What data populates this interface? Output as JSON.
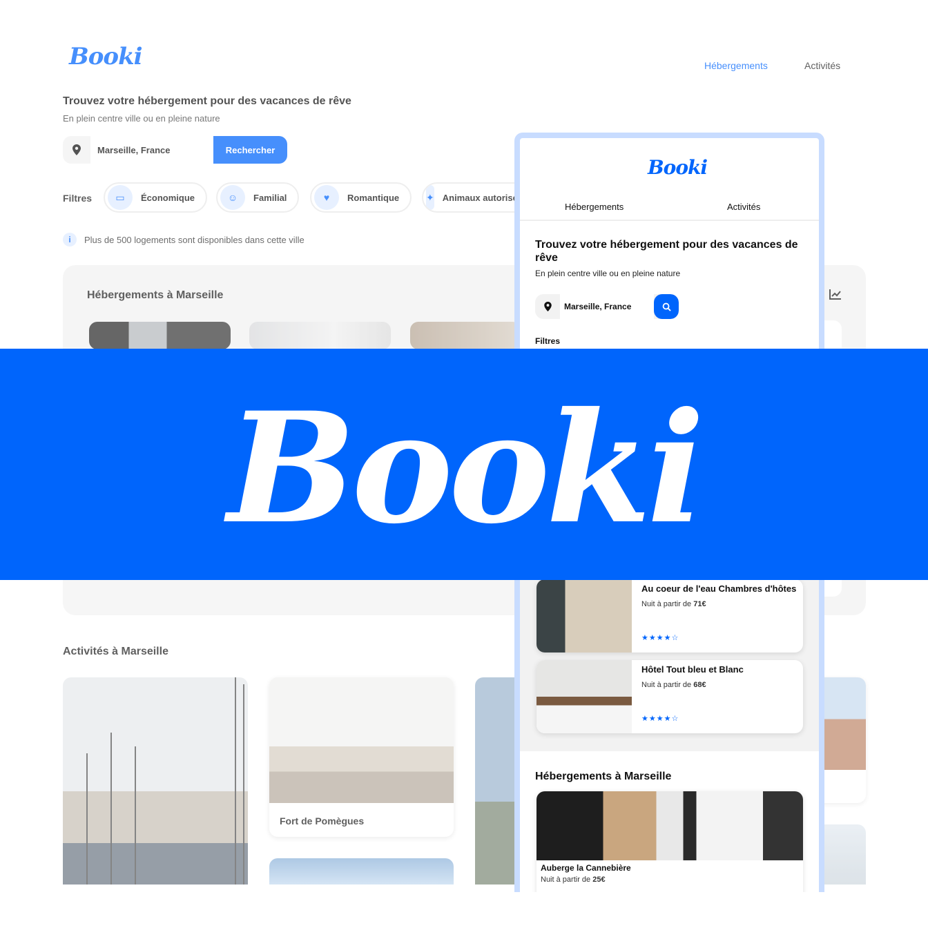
{
  "brand": "Booki",
  "colors": {
    "accent": "#0065fc",
    "accent_light": "#deebff",
    "panel": "#f2f2f2"
  },
  "desktop": {
    "nav": {
      "accommodations": "Hébergements",
      "activities": "Activités"
    },
    "hero": {
      "title": "Trouvez votre hébergement pour des vacances de rêve",
      "subtitle": "En plein centre ville ou en pleine nature"
    },
    "search": {
      "value": "Marseille, France",
      "button": "Rechercher"
    },
    "filters": {
      "label": "Filtres",
      "items": [
        {
          "label": "Économique",
          "icon": "money-icon"
        },
        {
          "label": "Familial",
          "icon": "child-icon"
        },
        {
          "label": "Romantique",
          "icon": "heart-icon"
        },
        {
          "label": "Animaux autorisés",
          "icon": "dog-icon"
        }
      ]
    },
    "info": "Plus de 500 logements sont disponibles dans cette ville",
    "accommodations_title": "Hébergements à Marseille",
    "activities_title": "Activités à Marseille",
    "activities": [
      {
        "label": "Fort de Pomègues"
      }
    ]
  },
  "mobile": {
    "tabs": {
      "accommodations": "Hébergements",
      "activities": "Activités"
    },
    "hero": {
      "title": "Trouvez votre hébergement pour des vacances de rêve",
      "subtitle": "En plein centre ville ou en pleine nature"
    },
    "search_value": "Marseille, France",
    "filters_label": "Filtres",
    "cards": [
      {
        "name": "Au coeur de l'eau Chambres d'hôtes",
        "price_prefix": "Nuit à partir de ",
        "price": "71€",
        "stars": "★★★★☆"
      },
      {
        "name": "Hôtel Tout bleu et Blanc",
        "price_prefix": "Nuit à partir de ",
        "price": "68€",
        "stars": "★★★★☆"
      }
    ],
    "section_title": "Hébergements à Marseille",
    "feature": {
      "name": "Auberge la Cannebière",
      "price_prefix": "Nuit à partir de ",
      "price": "25€"
    }
  },
  "banner": {
    "text": "Booki"
  }
}
